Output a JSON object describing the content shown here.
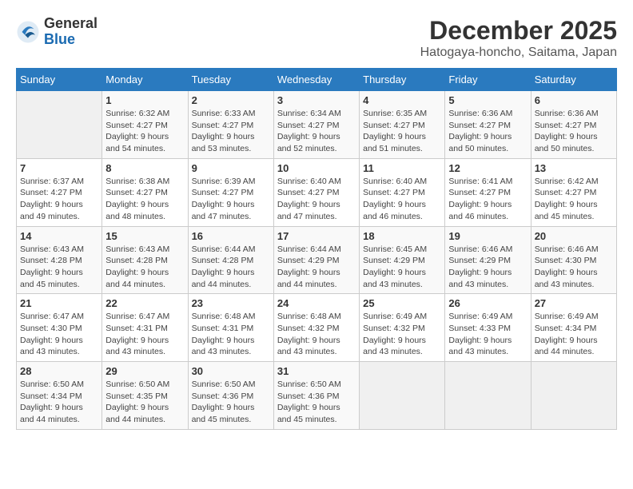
{
  "header": {
    "logo_general": "General",
    "logo_blue": "Blue",
    "month_title": "December 2025",
    "location": "Hatogaya-honcho, Saitama, Japan"
  },
  "weekdays": [
    "Sunday",
    "Monday",
    "Tuesday",
    "Wednesday",
    "Thursday",
    "Friday",
    "Saturday"
  ],
  "weeks": [
    [
      {
        "num": "",
        "info": ""
      },
      {
        "num": "1",
        "info": "Sunrise: 6:32 AM\nSunset: 4:27 PM\nDaylight: 9 hours\nand 54 minutes."
      },
      {
        "num": "2",
        "info": "Sunrise: 6:33 AM\nSunset: 4:27 PM\nDaylight: 9 hours\nand 53 minutes."
      },
      {
        "num": "3",
        "info": "Sunrise: 6:34 AM\nSunset: 4:27 PM\nDaylight: 9 hours\nand 52 minutes."
      },
      {
        "num": "4",
        "info": "Sunrise: 6:35 AM\nSunset: 4:27 PM\nDaylight: 9 hours\nand 51 minutes."
      },
      {
        "num": "5",
        "info": "Sunrise: 6:36 AM\nSunset: 4:27 PM\nDaylight: 9 hours\nand 50 minutes."
      },
      {
        "num": "6",
        "info": "Sunrise: 6:36 AM\nSunset: 4:27 PM\nDaylight: 9 hours\nand 50 minutes."
      }
    ],
    [
      {
        "num": "7",
        "info": "Sunrise: 6:37 AM\nSunset: 4:27 PM\nDaylight: 9 hours\nand 49 minutes."
      },
      {
        "num": "8",
        "info": "Sunrise: 6:38 AM\nSunset: 4:27 PM\nDaylight: 9 hours\nand 48 minutes."
      },
      {
        "num": "9",
        "info": "Sunrise: 6:39 AM\nSunset: 4:27 PM\nDaylight: 9 hours\nand 47 minutes."
      },
      {
        "num": "10",
        "info": "Sunrise: 6:40 AM\nSunset: 4:27 PM\nDaylight: 9 hours\nand 47 minutes."
      },
      {
        "num": "11",
        "info": "Sunrise: 6:40 AM\nSunset: 4:27 PM\nDaylight: 9 hours\nand 46 minutes."
      },
      {
        "num": "12",
        "info": "Sunrise: 6:41 AM\nSunset: 4:27 PM\nDaylight: 9 hours\nand 46 minutes."
      },
      {
        "num": "13",
        "info": "Sunrise: 6:42 AM\nSunset: 4:27 PM\nDaylight: 9 hours\nand 45 minutes."
      }
    ],
    [
      {
        "num": "14",
        "info": "Sunrise: 6:43 AM\nSunset: 4:28 PM\nDaylight: 9 hours\nand 45 minutes."
      },
      {
        "num": "15",
        "info": "Sunrise: 6:43 AM\nSunset: 4:28 PM\nDaylight: 9 hours\nand 44 minutes."
      },
      {
        "num": "16",
        "info": "Sunrise: 6:44 AM\nSunset: 4:28 PM\nDaylight: 9 hours\nand 44 minutes."
      },
      {
        "num": "17",
        "info": "Sunrise: 6:44 AM\nSunset: 4:29 PM\nDaylight: 9 hours\nand 44 minutes."
      },
      {
        "num": "18",
        "info": "Sunrise: 6:45 AM\nSunset: 4:29 PM\nDaylight: 9 hours\nand 43 minutes."
      },
      {
        "num": "19",
        "info": "Sunrise: 6:46 AM\nSunset: 4:29 PM\nDaylight: 9 hours\nand 43 minutes."
      },
      {
        "num": "20",
        "info": "Sunrise: 6:46 AM\nSunset: 4:30 PM\nDaylight: 9 hours\nand 43 minutes."
      }
    ],
    [
      {
        "num": "21",
        "info": "Sunrise: 6:47 AM\nSunset: 4:30 PM\nDaylight: 9 hours\nand 43 minutes."
      },
      {
        "num": "22",
        "info": "Sunrise: 6:47 AM\nSunset: 4:31 PM\nDaylight: 9 hours\nand 43 minutes."
      },
      {
        "num": "23",
        "info": "Sunrise: 6:48 AM\nSunset: 4:31 PM\nDaylight: 9 hours\nand 43 minutes."
      },
      {
        "num": "24",
        "info": "Sunrise: 6:48 AM\nSunset: 4:32 PM\nDaylight: 9 hours\nand 43 minutes."
      },
      {
        "num": "25",
        "info": "Sunrise: 6:49 AM\nSunset: 4:32 PM\nDaylight: 9 hours\nand 43 minutes."
      },
      {
        "num": "26",
        "info": "Sunrise: 6:49 AM\nSunset: 4:33 PM\nDaylight: 9 hours\nand 43 minutes."
      },
      {
        "num": "27",
        "info": "Sunrise: 6:49 AM\nSunset: 4:34 PM\nDaylight: 9 hours\nand 44 minutes."
      }
    ],
    [
      {
        "num": "28",
        "info": "Sunrise: 6:50 AM\nSunset: 4:34 PM\nDaylight: 9 hours\nand 44 minutes."
      },
      {
        "num": "29",
        "info": "Sunrise: 6:50 AM\nSunset: 4:35 PM\nDaylight: 9 hours\nand 44 minutes."
      },
      {
        "num": "30",
        "info": "Sunrise: 6:50 AM\nSunset: 4:36 PM\nDaylight: 9 hours\nand 45 minutes."
      },
      {
        "num": "31",
        "info": "Sunrise: 6:50 AM\nSunset: 4:36 PM\nDaylight: 9 hours\nand 45 minutes."
      },
      {
        "num": "",
        "info": ""
      },
      {
        "num": "",
        "info": ""
      },
      {
        "num": "",
        "info": ""
      }
    ]
  ]
}
